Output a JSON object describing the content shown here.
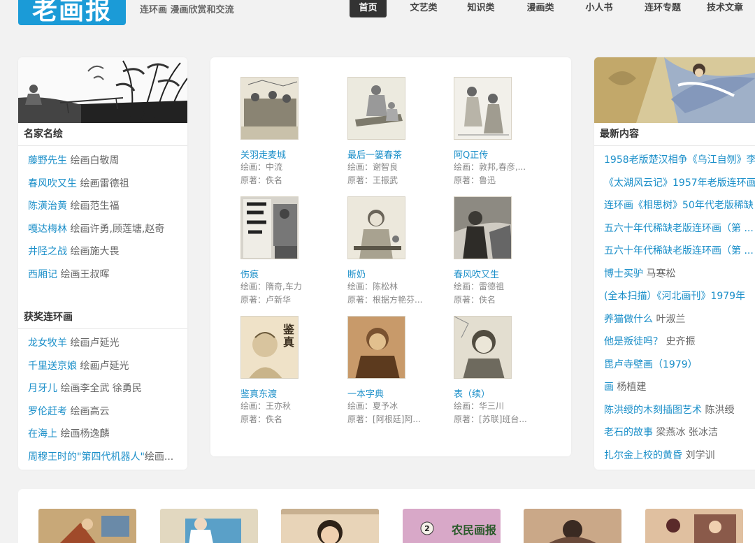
{
  "header": {
    "logo_text": "老画报",
    "tagline": "连环画 漫画欣赏和交流",
    "nav": [
      {
        "label": "首页",
        "active": true
      },
      {
        "label": "文艺类"
      },
      {
        "label": "知识类"
      },
      {
        "label": "漫画类"
      },
      {
        "label": "小人书"
      },
      {
        "label": "连环专题"
      },
      {
        "label": "技术文章"
      }
    ]
  },
  "left": {
    "famous": {
      "title": "名家名绘",
      "items": [
        {
          "title": "藤野先生",
          "artist": "绘画白敬周"
        },
        {
          "title": "春风吹又生",
          "artist": "绘画雷德祖"
        },
        {
          "title": "陈潢治黄",
          "artist": "绘画范生福"
        },
        {
          "title": "嘎达梅林",
          "artist": "绘画许勇,顾莲塘,赵奇"
        },
        {
          "title": "井陉之战",
          "artist": "绘画施大畏"
        },
        {
          "title": "西厢记",
          "artist": "绘画王叔晖"
        }
      ]
    },
    "award": {
      "title": "获奖连环画",
      "items": [
        {
          "title": "龙女牧羊",
          "artist": "绘画卢延光"
        },
        {
          "title": "千里送京娘",
          "artist": "绘画卢延光"
        },
        {
          "title": "月牙儿",
          "artist": "绘画李全武 徐勇民"
        },
        {
          "title": "罗伦赶考",
          "artist": "绘画高云"
        },
        {
          "title": "在海上",
          "artist": "绘画杨逸麟"
        },
        {
          "title": "周穆王时的\"第四代机器人\"",
          "artist": "绘画..."
        }
      ]
    }
  },
  "grid": {
    "label_artist": "绘画：",
    "label_author": "原著：",
    "items": [
      {
        "title": "关羽走麦城",
        "artist": "中流",
        "author": "佚名"
      },
      {
        "title": "最后一篓春茶",
        "artist": "谢智良",
        "author": "王振武"
      },
      {
        "title": "阿Q正传",
        "artist": "敦邦,春彦,...",
        "author": "鲁迅"
      },
      {
        "title": "伤痕",
        "artist": "隋奇,车力",
        "author": "卢新华"
      },
      {
        "title": "断奶",
        "artist": "陈松林",
        "author": "根据方艳芬..."
      },
      {
        "title": "春风吹又生",
        "artist": "雷德祖",
        "author": "佚名"
      },
      {
        "title": "鉴真东渡",
        "artist": "王亦秋",
        "author": "佚名"
      },
      {
        "title": "一本字典",
        "artist": "夏予冰",
        "author": "[阿根廷]阿..."
      },
      {
        "title": "表（续）",
        "artist": "华三川",
        "author": "[苏联]班台..."
      }
    ]
  },
  "right": {
    "title": "最新内容",
    "items": [
      {
        "title": "1958老版楚汉相争《乌江自刎》李",
        "artist": ""
      },
      {
        "title": "《太湖风云记》1957年老版连环画",
        "artist": ""
      },
      {
        "title": "连环画《相思树》50年代老版稀缺",
        "artist": ""
      },
      {
        "title": "五六十年代稀缺老版连环画（第 ...",
        "artist": ""
      },
      {
        "title": "五六十年代稀缺老版连环画（第 ...",
        "artist": ""
      },
      {
        "title": "博士买驴",
        "artist": "马寒松"
      },
      {
        "title": "(全本扫描）《河北画刊》1979年",
        "artist": ""
      },
      {
        "title": "养猫做什么",
        "artist": "叶淑兰"
      },
      {
        "title": "他是叛徒吗？",
        "artist": "史齐振"
      },
      {
        "title": "毘卢寺壁画（1979）",
        "artist": ""
      },
      {
        "title": "画",
        "artist": "杨植建"
      },
      {
        "title": "陈洪绶的木刻插图艺术",
        "artist": "陈洪绶"
      },
      {
        "title": "老石的故事",
        "artist": "梁燕冰 张冰洁"
      },
      {
        "title": "扎尔金上校的黄昏",
        "artist": "刘学训"
      }
    ]
  },
  "bottom": {
    "magazine_title": "农民画报",
    "magazine_issue": "2"
  }
}
